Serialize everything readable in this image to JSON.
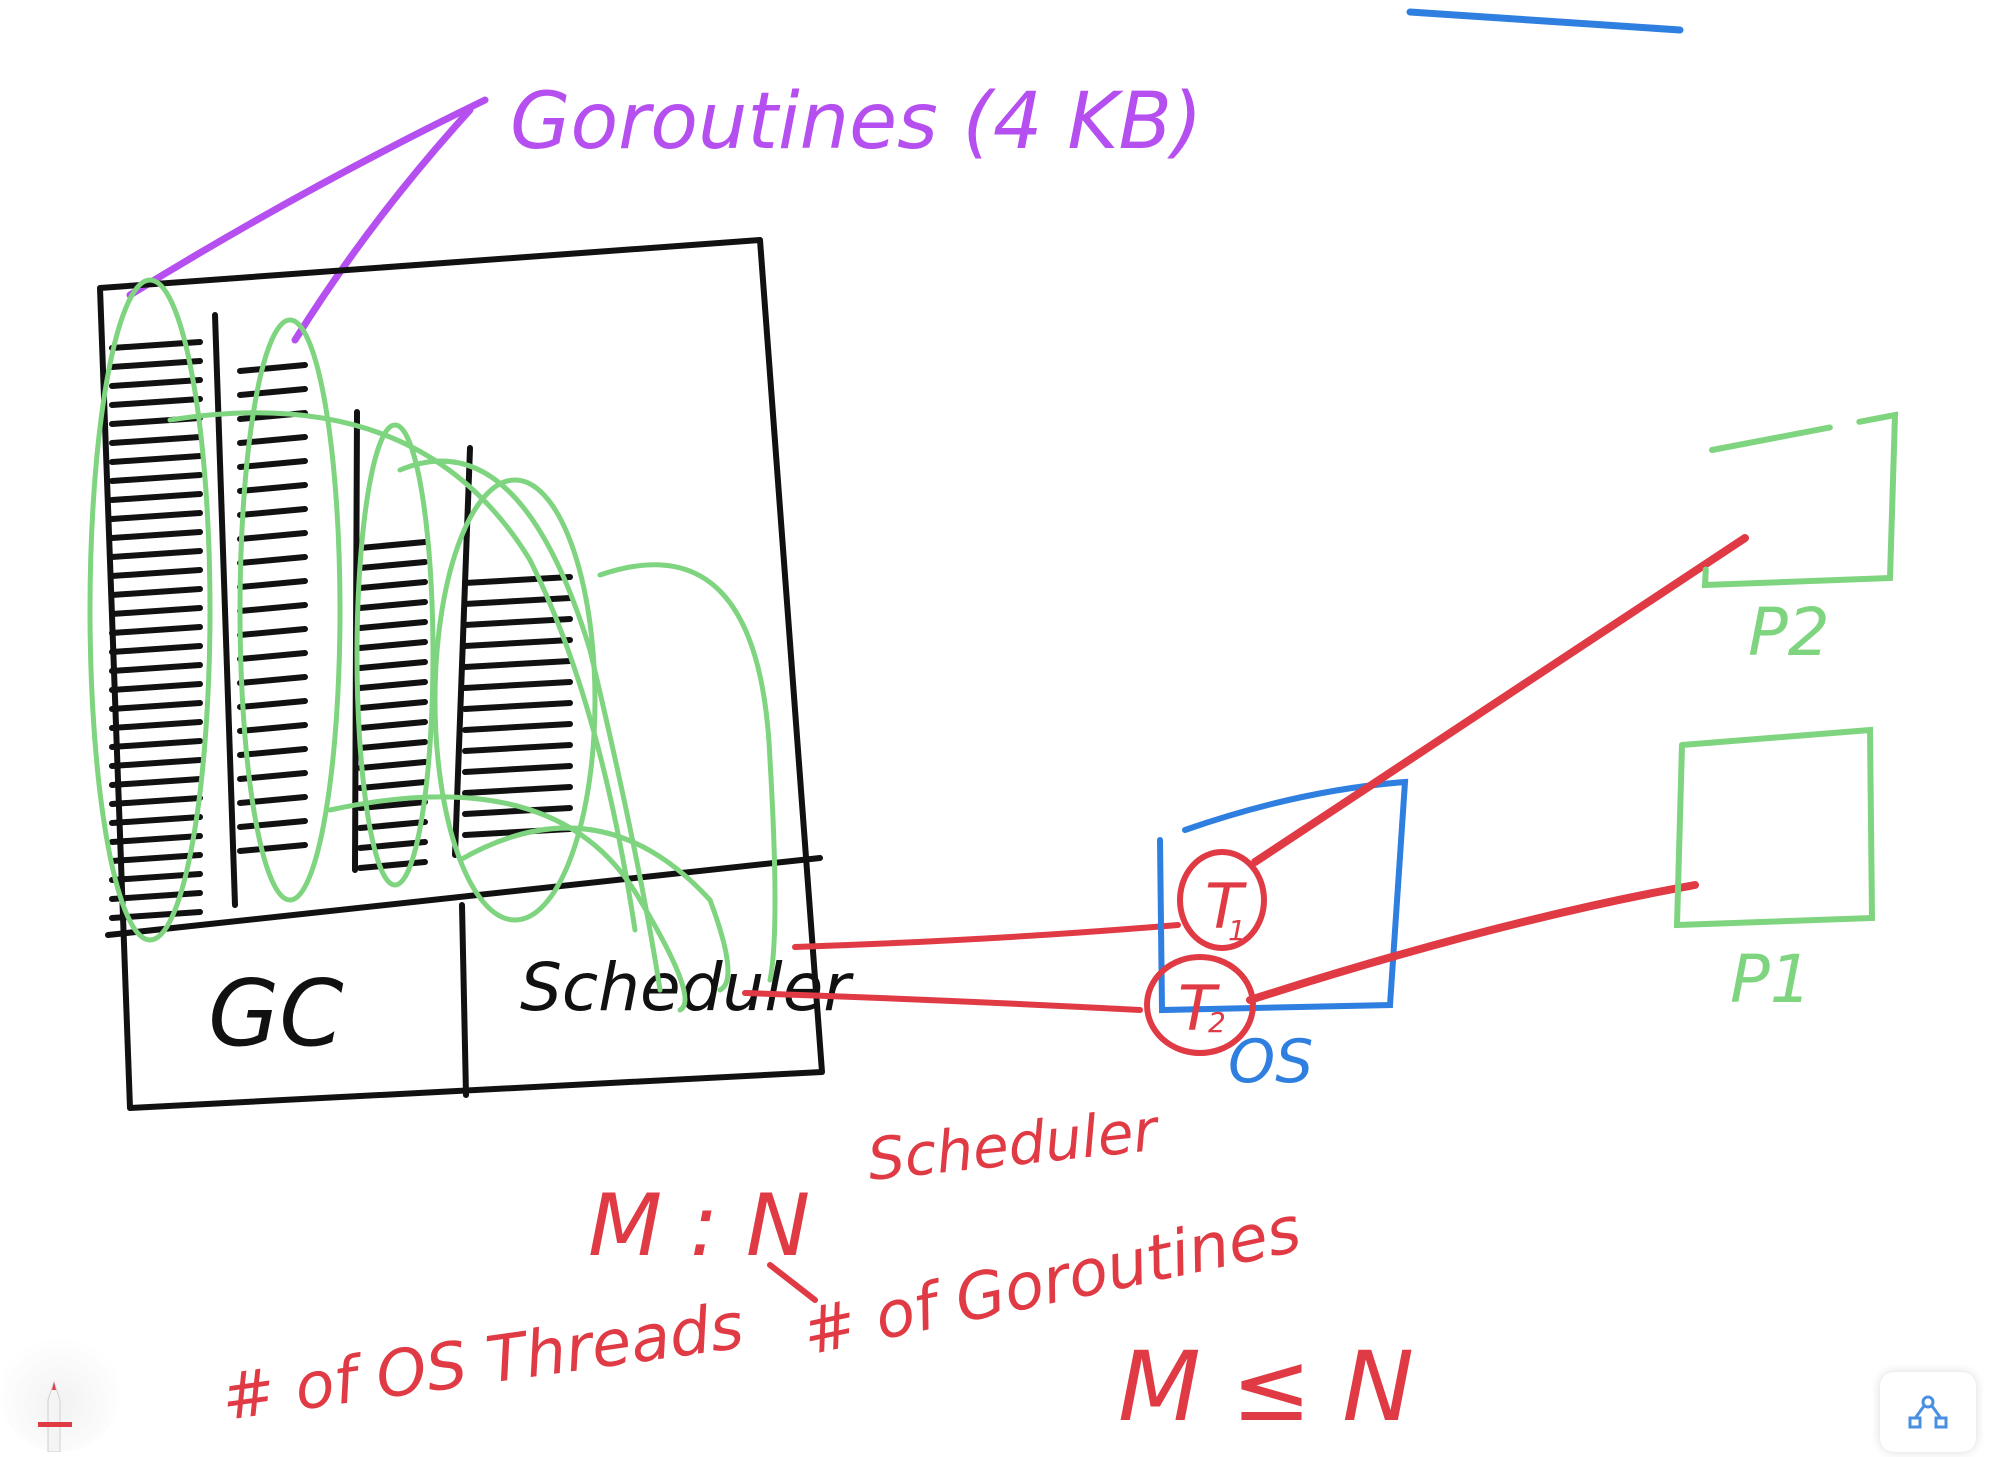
{
  "labels": {
    "goroutines": "Goroutines (4 KB)",
    "gc": "GC",
    "scheduler": "Scheduler",
    "os": "OS",
    "t1": "T",
    "t1_sub": "1",
    "t2": "T",
    "t2_sub": "2",
    "p1": "P1",
    "p2": "P2",
    "mn": "M : N",
    "mn_scheduler": "Scheduler",
    "os_threads": "# of OS Threads",
    "num_goroutines": "# of Goroutines",
    "m_le_n": "M ≤ N"
  },
  "colors": {
    "ink": "#111111",
    "green": "#7fd47f",
    "purple": "#b64ff0",
    "red": "#e03a45",
    "blue": "#2f7fe0",
    "pen_tip": "#e03a45"
  },
  "icons": {
    "pen": "pen-tool-icon",
    "share": "share-icon"
  }
}
